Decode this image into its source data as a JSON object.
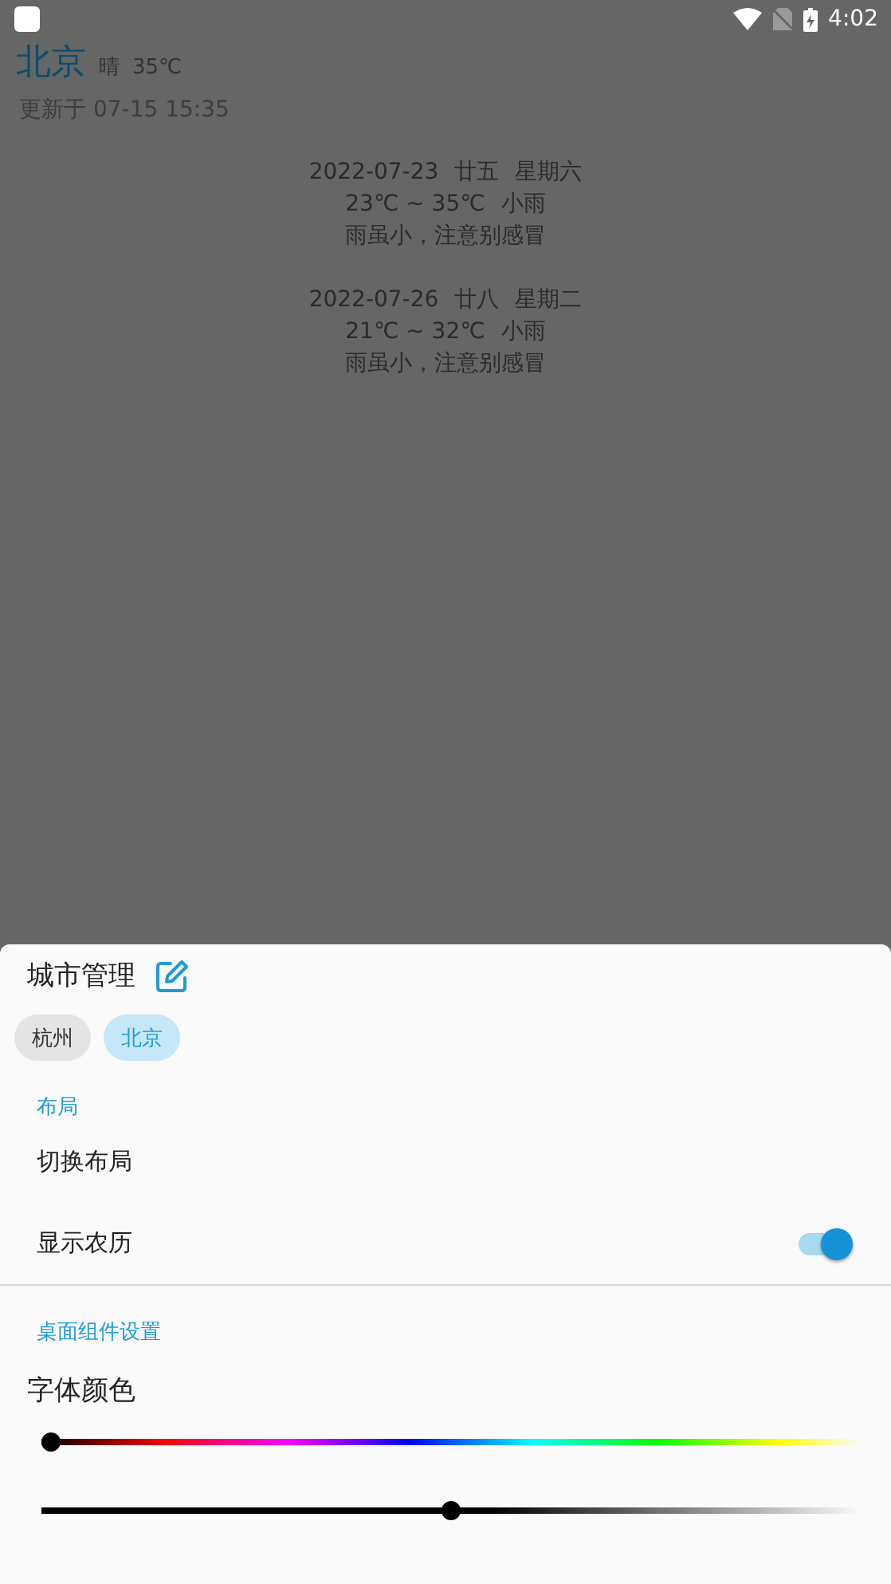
{
  "status_bar": {
    "time": "4:02"
  },
  "weather": {
    "city": "北京",
    "condition": "晴",
    "temperature": "35℃",
    "updated": "更新于 07-15 15:35"
  },
  "forecast": [
    {
      "date": "2022-07-23",
      "lunar": "廿五",
      "weekday": "星期六",
      "temp_range": "23℃ ~ 35℃",
      "weather": "小雨",
      "tip": "雨虽小，注意别感冒"
    },
    {
      "date": "2022-07-26",
      "lunar": "廿八",
      "weekday": "星期二",
      "temp_range": "21℃ ~ 32℃",
      "weather": "小雨",
      "tip": "雨虽小，注意别感冒"
    }
  ],
  "sheet": {
    "title": "城市管理",
    "cities": [
      {
        "name": "杭州",
        "selected": false
      },
      {
        "name": "北京",
        "selected": true
      }
    ],
    "sections": [
      {
        "header": "布局",
        "items": [
          {
            "kind": "plain",
            "label": "切换布局"
          },
          {
            "kind": "switch",
            "label": "显示农历",
            "on": true
          }
        ]
      },
      {
        "header": "桌面组件设置",
        "items": [
          {
            "kind": "label",
            "label": "字体颜色"
          },
          {
            "kind": "hue_slider",
            "level": 0.0
          },
          {
            "kind": "alpha_slider",
            "level": 0.5
          }
        ]
      }
    ]
  }
}
